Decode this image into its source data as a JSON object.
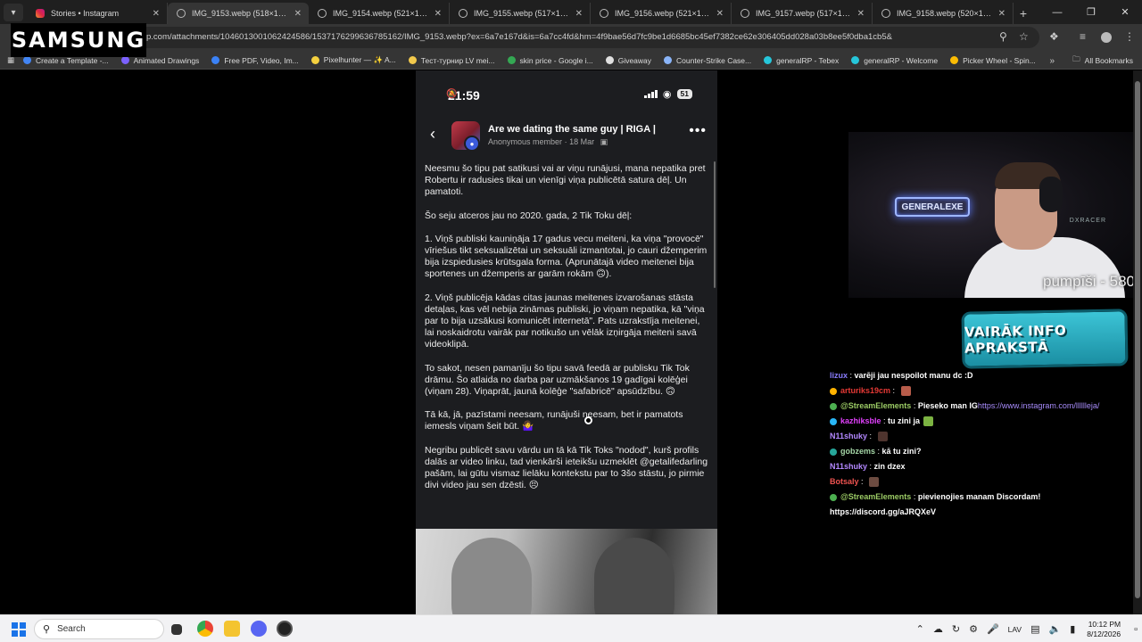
{
  "browser": {
    "tabs": [
      {
        "title": "Stories • Instagram",
        "icon": "instagram-icon",
        "active": false
      },
      {
        "title": "IMG_9153.webp (518×1024)",
        "icon": "globe-icon",
        "active": true
      },
      {
        "title": "IMG_9154.webp (521×1024)",
        "icon": "globe-icon",
        "active": false
      },
      {
        "title": "IMG_9155.webp (517×1024)",
        "icon": "globe-icon",
        "active": false
      },
      {
        "title": "IMG_9156.webp (521×1024)",
        "icon": "globe-icon",
        "active": false
      },
      {
        "title": "IMG_9157.webp (517×1024)",
        "icon": "globe-icon",
        "active": false
      },
      {
        "title": "IMG_9158.webp (520×1024)",
        "icon": "globe-icon",
        "active": false
      }
    ],
    "url": "p.com/attachments/1046013001062424586/1537176299636785162/IMG_9153.webp?ex=6a7e167d&is=6a7cc4fd&hm=4f9bae56d7fc9be1d6685bc45ef7382ce62e306405dd028a03b8ee5f0dba1cb5&",
    "bookmarks": [
      {
        "label": "Create a Template -...",
        "color": "#4285f4"
      },
      {
        "label": "Animated Drawings",
        "color": "#7b61ff"
      },
      {
        "label": "Free PDF, Video, Im...",
        "color": "#3b82f6"
      },
      {
        "label": "Pixelhunter — ✨ A...",
        "color": "#f4d03f"
      },
      {
        "label": "Тест-турнир LV mei...",
        "color": "#f2c94c"
      },
      {
        "label": "skin price - Google i...",
        "color": "#34a853"
      },
      {
        "label": "Giveaway",
        "color": "#e0e0e0"
      },
      {
        "label": "Counter-Strike Case...",
        "color": "#8ab4f8"
      },
      {
        "label": "generalRP - Tebex",
        "color": "#26c6da"
      },
      {
        "label": "generalRP - Welcome",
        "color": "#26c6da"
      },
      {
        "label": "Picker Wheel - Spin...",
        "color": "#fbbc04"
      }
    ],
    "all_bookmarks": "All Bookmarks"
  },
  "overlay_logo": "SAMSUNG",
  "phone": {
    "time": "21:59",
    "battery": "51",
    "group_title": "Are we dating the same guy | RIGA |",
    "author": "Anonymous member",
    "date": "18 Mar",
    "paragraphs": [
      "Neesmu šo tipu pat satikusi vai ar viņu runājusi, mana nepatika pret Robertu ir radusies tikai un vienīgi viņa publicētā satura dēļ. Un pamatoti.",
      "Šo seju atceros jau no 2020. gada, 2 Tik Toku dēļ:",
      "1. Viņš publiski kauniņāja 17 gadus vecu meiteni, ka viņa \"provocē\" vīriešus tikt seksualizētai un seksuāli izmantotai, jo cauri džemperim bija izspiedusies krūtsgala forma. (Aprunātajā video meitenei bija sportenes un džemperis ar garām rokām 🙃).",
      "2. Viņš publicēja kādas citas jaunas meitenes izvarošanas stāsta detaļas, kas vēl nebija zināmas publiski, jo viņam nepatika, kā \"viņa par to bija uzsākusi komunicēt internetā\". Pats uzrakstīja meitenei, lai noskaidrotu vairāk par notikušo un vēlāk izņirgāja meiteni savā videoklipā.",
      "To sakot, nesen pamanīju šo tipu savā feedā ar publisku Tik Tok drāmu. Šo atlaida no darba par uzmākšanos 19 gadīgai kolēģei (viņam 28). Viņaprāt, jaunā kolēģe \"safabricē\" apsūdzību. 🙃",
      "Tā kā, jā, pazīstami neesam, runājuši neesam, bet ir pamatots iemesls viņam šeit būt. 🤷‍♀️",
      "Negribu publicēt savu vārdu un tā kā Tik Toks \"nodod\", kurš profils dalās ar video linku, tad vienkārši ieteikšu uzmeklēt @getalifedarling pašām, lai gūtu vismaz lielāku kontekstu par to 3šo stāstu, jo pirmie divi video jau sen dzēsti. 😣"
    ]
  },
  "stream": {
    "neon_sign": "GENERALEXE",
    "chair_brand": "DXRACER",
    "overlay_text": "pumpīši - 580",
    "info_banner": "VAIRĀK INFO APRAKSTĀ",
    "chat": [
      {
        "user": "lizux",
        "user_color": "#8a7dff",
        "text": "varēji jau nespoilot manu dc :D",
        "badge": "",
        "emote": ""
      },
      {
        "user": "arturiks19cm",
        "user_color": "#e53935",
        "text": "",
        "badge": "#ffb300",
        "emote": "#b85c4a"
      },
      {
        "user": "@StreamElements",
        "user_color": "#9ccc65",
        "text": "Pieseko man IG ",
        "link": "https://www.instagram.com/lllllleja/",
        "badge": "#4caf50",
        "emote": ""
      },
      {
        "user": "kazhiksble",
        "user_color": "#e040fb",
        "text": "tu zini ja",
        "badge": "#29b6f6",
        "emote": "#7cb342"
      },
      {
        "user": "N11shuky",
        "user_color": "#b388ff",
        "text": "",
        "badge": "",
        "emote": "#4e342e"
      },
      {
        "user": "gobzems",
        "user_color": "#a5d6a7",
        "text": "kā tu zini?",
        "badge": "#26a69a",
        "emote": ""
      },
      {
        "user": "N11shuky",
        "user_color": "#b388ff",
        "text": "zin dzex",
        "badge": "",
        "emote": ""
      },
      {
        "user": "Botsaly",
        "user_color": "#ef5350",
        "text": "",
        "badge": "",
        "emote": "#6d4c41"
      },
      {
        "user": "@StreamElements",
        "user_color": "#9ccc65",
        "text": "pievienojies manam Discordam!",
        "badge": "#4caf50",
        "emote": ""
      },
      {
        "user": "",
        "user_color": "#ffffff",
        "text": "https://discord.gg/aJRQXeV",
        "badge": "",
        "emote": ""
      }
    ]
  },
  "taskbar": {
    "search_placeholder": "Search",
    "language": "LAV",
    "time": "10:12 PM",
    "date": "8/12/2026"
  }
}
